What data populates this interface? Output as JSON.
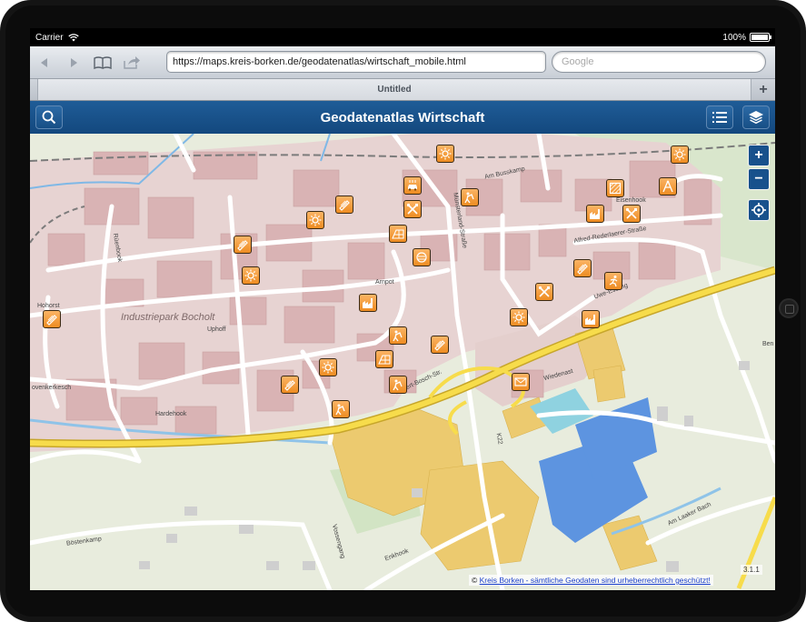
{
  "statusbar": {
    "carrier": "Carrier",
    "battery": "100%",
    "battery_level": 1.0
  },
  "browser": {
    "url": "https://maps.kreis-borken.de/geodatenatlas/wirtschaft_mobile.html",
    "search_placeholder": "Google",
    "tab_title": "Untitled",
    "new_tab_label": "+"
  },
  "app": {
    "title": "Geodatenatlas Wirtschaft"
  },
  "map": {
    "zoom_in": "+",
    "zoom_out": "−",
    "version": "3.1.1",
    "copyright_prefix": "©",
    "copyright_link": "Kreis Borken - sämtliche Geodaten sind urheberrechtlich geschützt!",
    "area_label": "Industriepark Bocholt",
    "streets": {
      "uphoff": "Uphoff",
      "ruenbook": "Rüenbook",
      "hardehook": "Hardehook",
      "ovenkerkesch": "ovenkerkesch",
      "hohorst": "Hohorst",
      "boestenkamp": "Böstenkamp",
      "vossengang": "Vossengang",
      "enkhook": "Enkhook",
      "wiedenast": "Wiedenast",
      "k22": "K22",
      "am_laaker_bach": "Am Laaker Bach",
      "alfred_rederlaerer": "Alfred-Rederlaerer-Straße",
      "muensterland": "Münsterland-Straße",
      "am_busskamp": "Am Busskamp",
      "eisenhook": "Eisenhook",
      "arnpot": "Arnpot",
      "robert_bosch": "Robert-Bosch-Str.",
      "uwe_essling": "Uwe-Essling",
      "ben": "Ben"
    }
  },
  "colors": {
    "header": "#1a5288",
    "poi": "#f39a32",
    "road_major": "#f6d64a",
    "industry": "#e6cfcc",
    "water": "#8fc3e8"
  }
}
